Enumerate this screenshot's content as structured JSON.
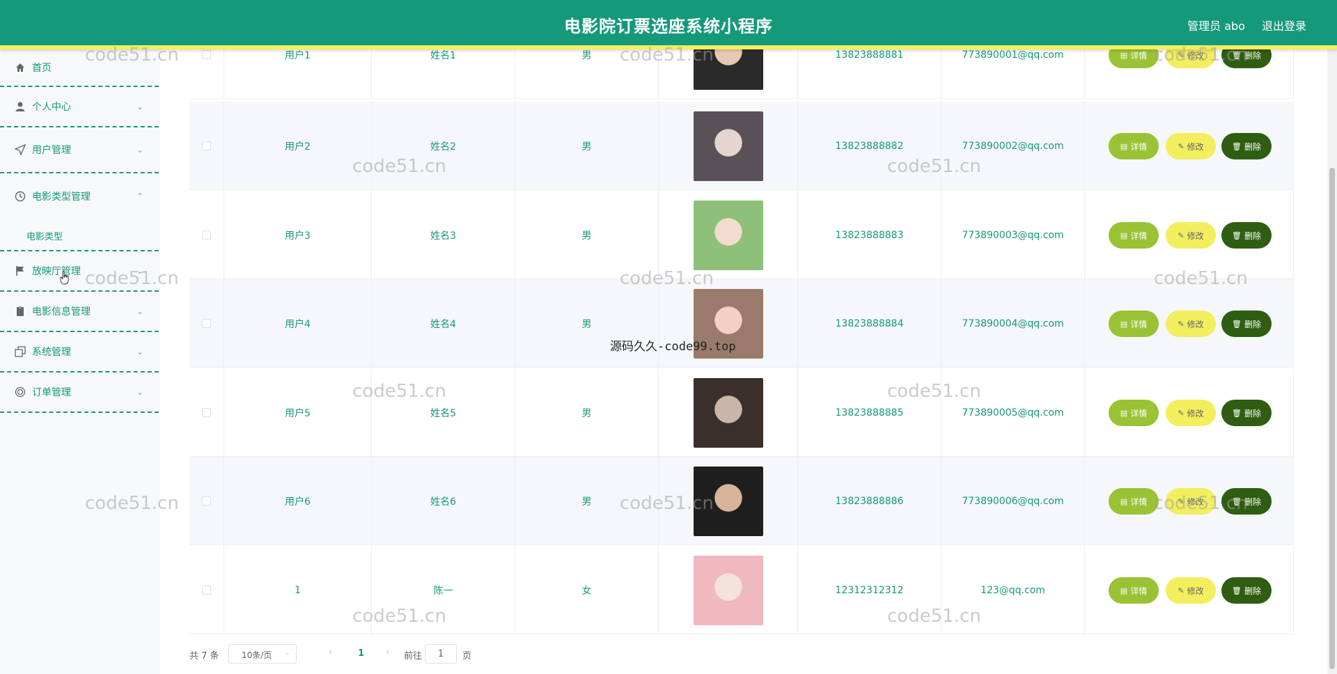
{
  "header": {
    "title": "电影院订票选座系统小程序",
    "admin": "管理员 abo",
    "logout": "退出登录"
  },
  "colors": {
    "primary": "#14997a",
    "accent_yellow": "#f2ee5e",
    "detail_btn": "#99c334",
    "delete_btn": "#2f5d11"
  },
  "sidebar": {
    "items": [
      {
        "label": "首页",
        "icon": "home-icon"
      },
      {
        "label": "个人中心",
        "icon": "user-icon"
      },
      {
        "label": "用户管理",
        "icon": "send-icon"
      },
      {
        "label": "电影类型管理",
        "icon": "clock-icon"
      },
      {
        "label": "放映厅管理",
        "icon": "flag-icon"
      },
      {
        "label": "电影信息管理",
        "icon": "clipboard-icon"
      },
      {
        "label": "系统管理",
        "icon": "copy-icon"
      },
      {
        "label": "订单管理",
        "icon": "ticket-icon"
      }
    ],
    "submenu": {
      "label": "电影类型"
    }
  },
  "table": {
    "rows": [
      {
        "account": "用户1",
        "name": "姓名1",
        "gender": "男",
        "phone": "13823888881",
        "email": "773890001@qq.com"
      },
      {
        "account": "用户2",
        "name": "姓名2",
        "gender": "男",
        "phone": "13823888882",
        "email": "773890002@qq.com"
      },
      {
        "account": "用户3",
        "name": "姓名3",
        "gender": "男",
        "phone": "13823888883",
        "email": "773890003@qq.com"
      },
      {
        "account": "用户4",
        "name": "姓名4",
        "gender": "男",
        "phone": "13823888884",
        "email": "773890004@qq.com"
      },
      {
        "account": "用户5",
        "name": "姓名5",
        "gender": "男",
        "phone": "13823888885",
        "email": "773890005@qq.com"
      },
      {
        "account": "用户6",
        "name": "姓名6",
        "gender": "男",
        "phone": "13823888886",
        "email": "773890006@qq.com"
      },
      {
        "account": "1",
        "name": "陈一",
        "gender": "女",
        "phone": "12312312312",
        "email": "123@qq.com"
      }
    ],
    "buttons": {
      "detail": "详情",
      "edit": "修改",
      "delete": "删除"
    }
  },
  "pagination": {
    "total": "共 7 条",
    "page_size": "10条/页",
    "current_page": "1",
    "goto_label": "前往",
    "goto_value": "1",
    "page_unit": "页"
  },
  "watermarks": {
    "site": "code51.cn",
    "overlay": "源码久久-code99.top"
  }
}
